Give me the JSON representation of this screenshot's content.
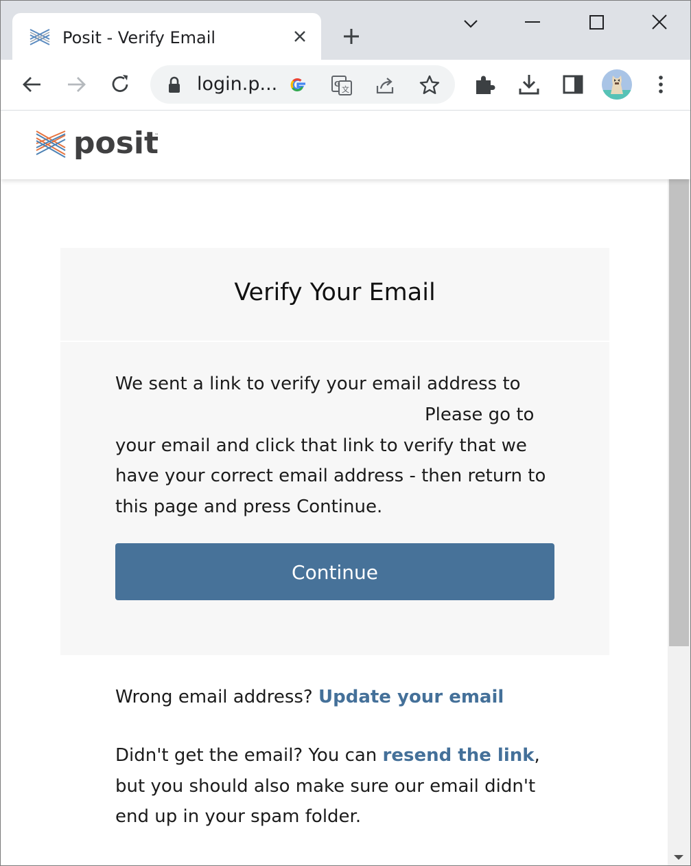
{
  "browser": {
    "tab": {
      "title": "Posit - Verify Email",
      "favicon": "posit-logo-icon"
    },
    "omnibox": {
      "url": "login.p..."
    },
    "colors": {
      "tabstrip": "#dee1e6",
      "omnibox": "#f1f3f4"
    }
  },
  "site": {
    "logo_text": "posit",
    "card": {
      "title": "Verify Your Email",
      "message_part1": "We sent a link to verify your email address to",
      "message_part2": "Please go to your email and click that link to verify that we have your correct email address - then return to this page and press Continue.",
      "continue_label": "Continue"
    },
    "wrong_email": {
      "prefix": "Wrong email address? ",
      "link": "Update your email"
    },
    "resend": {
      "prefix": "Didn't get the email? You can ",
      "link": "resend the link",
      "suffix": ", but you should also make sure our email didn't end up in your spam folder."
    },
    "colors": {
      "button": "#477299",
      "link": "#447099",
      "card": "#f7f7f7"
    }
  }
}
